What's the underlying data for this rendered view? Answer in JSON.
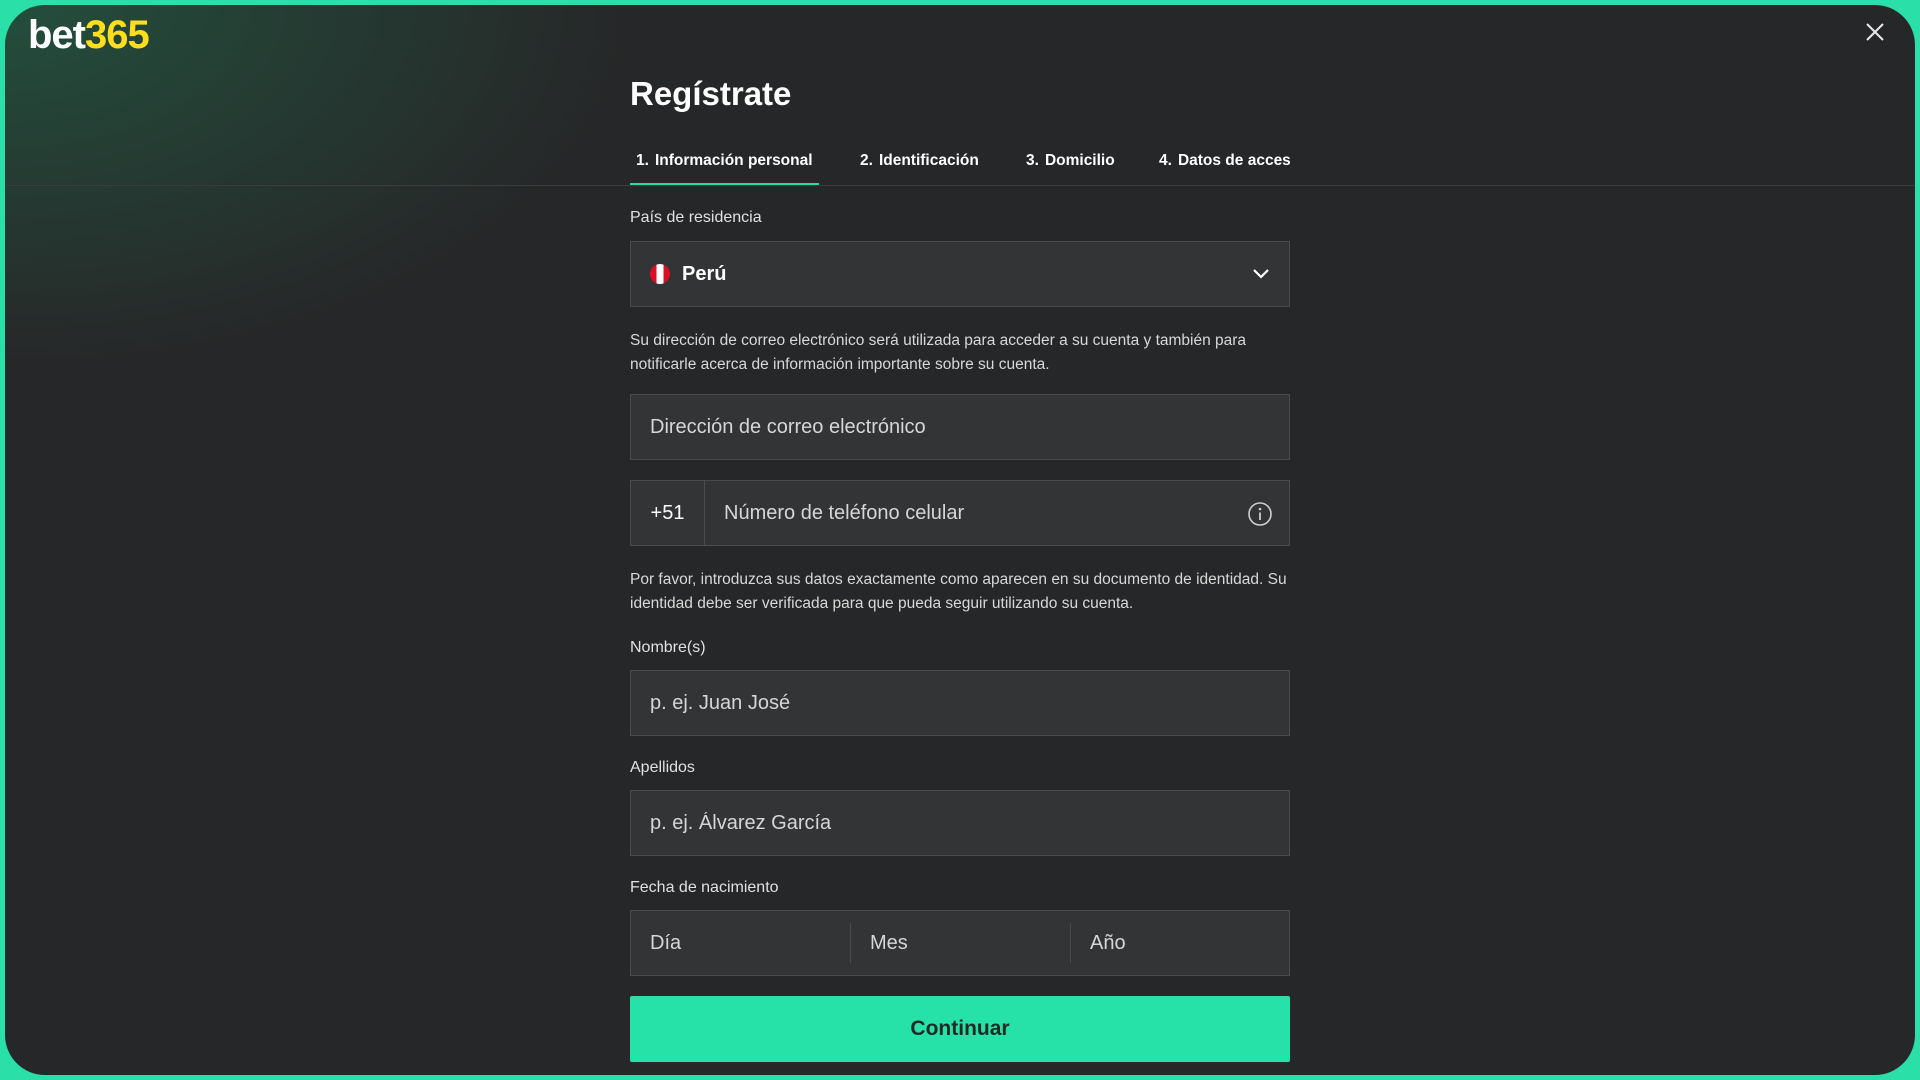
{
  "brand": {
    "logo_part1": "bet",
    "logo_part2": "365"
  },
  "colors": {
    "accent": "#26e2a9",
    "logo_yellow": "#ffdf1b",
    "background": "#262728"
  },
  "title": "Regístrate",
  "tabs": [
    {
      "num": "1.",
      "label": "Información personal",
      "active": true
    },
    {
      "num": "2.",
      "label": "Identificación",
      "active": false
    },
    {
      "num": "3.",
      "label": "Domicilio",
      "active": false
    },
    {
      "num": "4.",
      "label": "Datos de acceso",
      "active": false
    }
  ],
  "country": {
    "label": "País de residencia",
    "value": "Perú",
    "icon": "peru-flag-icon"
  },
  "email": {
    "help": "Su dirección de correo electrónico será utilizada para acceder a su cuenta y también para notificarle acerca de información importante sobre su cuenta.",
    "placeholder": "Dirección de correo electrónico"
  },
  "phone": {
    "prefix": "+51",
    "placeholder": "Número de teléfono celular",
    "icon": "info-icon"
  },
  "identity_help": "Por favor, introduzca sus datos exactamente como aparecen en su documento de identidad. Su identidad debe ser verificada para que pueda seguir utilizando su cuenta.",
  "first_name": {
    "label": "Nombre(s)",
    "placeholder": "p. ej. Juan José"
  },
  "last_name": {
    "label": "Apellidos",
    "placeholder": "p. ej. Álvarez García"
  },
  "dob": {
    "label": "Fecha de nacimiento",
    "day": "Día",
    "month": "Mes",
    "year": "Año"
  },
  "continue_label": "Continuar"
}
